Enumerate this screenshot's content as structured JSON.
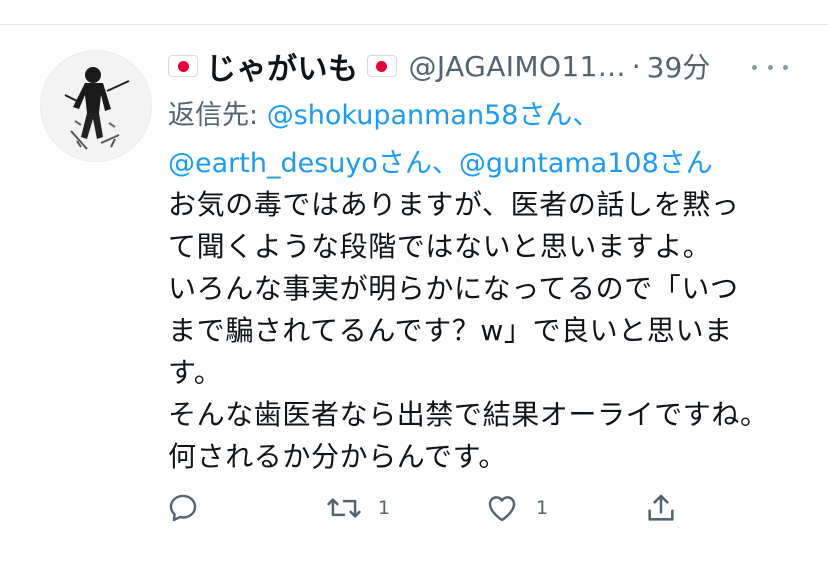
{
  "tweet": {
    "display_name": "じゃがいも",
    "handle": "@JAGAIMO11...",
    "separator": "·",
    "time": "39分",
    "reply_prefix": "返信先:",
    "mentions": [
      "@shokupanman58",
      "@earth_desuyo",
      "@guntama108"
    ],
    "san": "さん",
    "comma": "、",
    "body": "お気の毒ではありますが、医者の話しを黙っ\nて聞くような段階ではないと思いますよ。\nいろんな事実が明らかになってるので「いつ\nまで騙されてるんです？w」で良いと思いま\nす。\nそんな歯医者なら出禁で結果オーライですね。\n何されるか分からんです。",
    "retweet_count": "1",
    "like_count": "1"
  },
  "icons": {
    "flag": "japan-flag-icon",
    "more": "more-horizontal-icon",
    "reply": "reply-icon",
    "retweet": "retweet-icon",
    "like": "heart-icon",
    "share": "share-icon"
  },
  "colors": {
    "link": "#1d9bf0",
    "secondary_text": "#536471",
    "flag_red": "#e3003c"
  }
}
